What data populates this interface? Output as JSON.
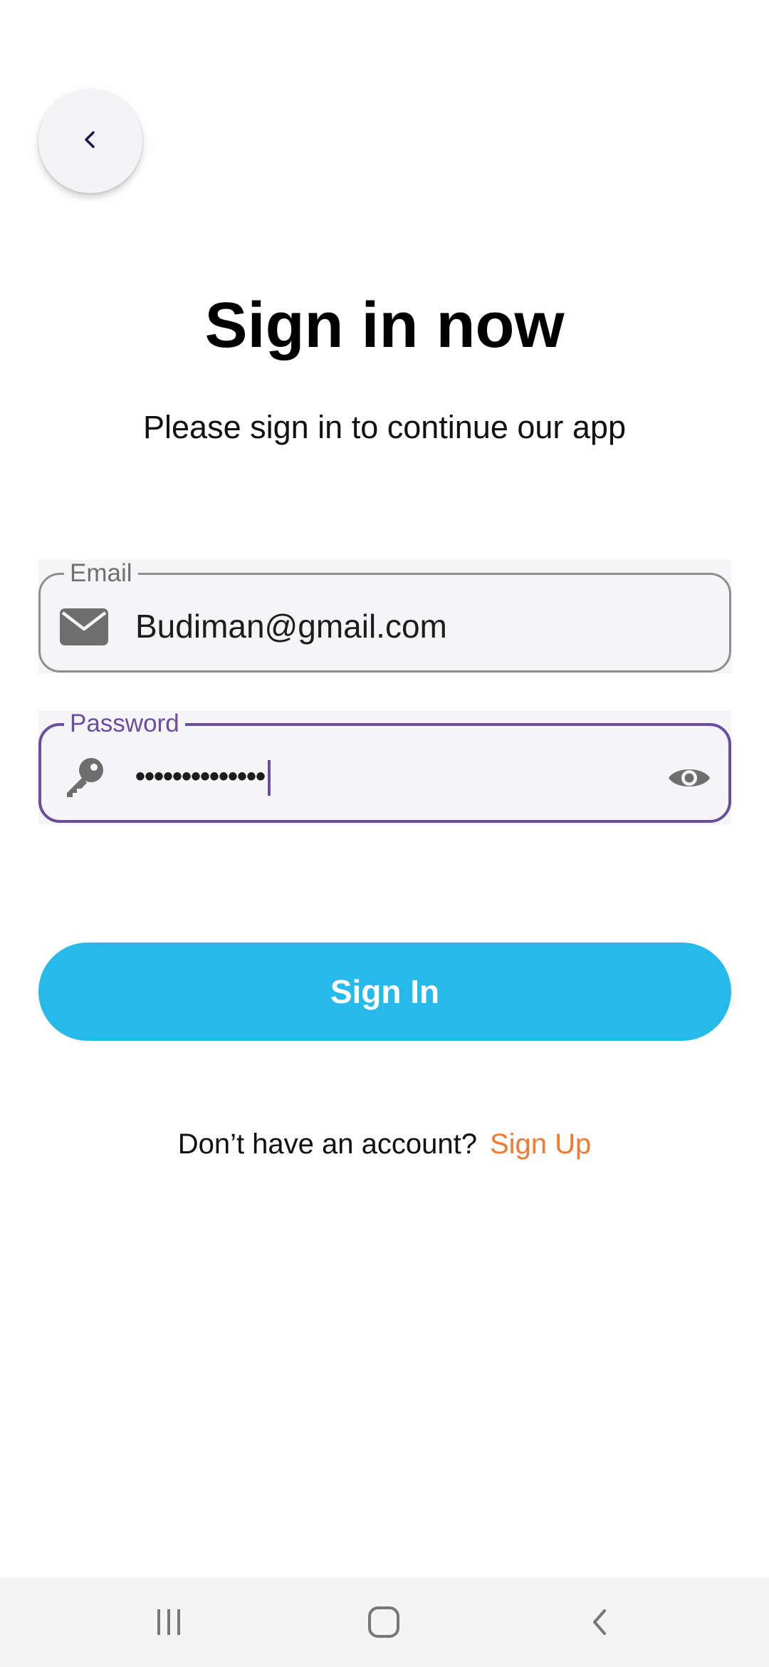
{
  "header": {
    "back_icon": "chevron-left-icon"
  },
  "page": {
    "title": "Sign in now",
    "subtitle": "Please sign in to continue our app"
  },
  "form": {
    "email": {
      "label": "Email",
      "value": "Budiman@gmail.com",
      "icon": "mail-icon"
    },
    "password": {
      "label": "Password",
      "value": "••••••••••••••",
      "icon": "key-icon",
      "toggle_icon": "eye-icon"
    },
    "submit_label": "Sign In"
  },
  "footer": {
    "question": "Don’t have an account?",
    "signup_label": "Sign Up"
  },
  "system_nav": {
    "items": [
      "recents-icon",
      "home-icon",
      "back-icon"
    ]
  },
  "colors": {
    "accent": "#26b9ea",
    "focus": "#6a4fa0",
    "link": "#f07a30"
  }
}
